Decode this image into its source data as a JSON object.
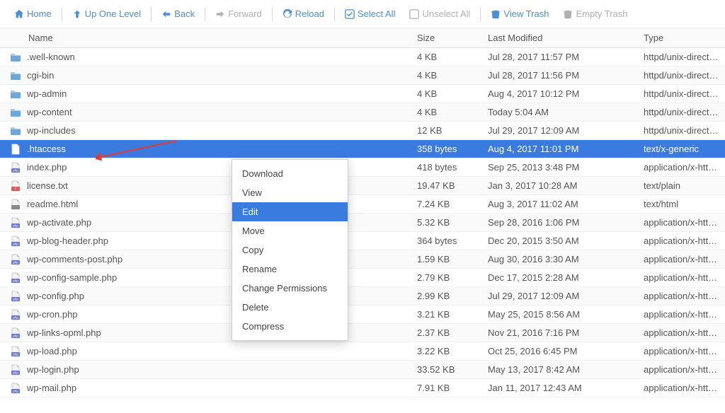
{
  "toolbar": {
    "home": "Home",
    "up": "Up One Level",
    "back": "Back",
    "forward": "Forward",
    "reload": "Reload",
    "select_all": "Select All",
    "unselect_all": "Unselect All",
    "view_trash": "View Trash",
    "empty_trash": "Empty Trash"
  },
  "columns": {
    "name": "Name",
    "size": "Size",
    "modified": "Last Modified",
    "type": "Type"
  },
  "files": [
    {
      "icon": "folder",
      "name": ".well-known",
      "size": "4 KB",
      "modified": "Jul 28, 2017 11:57 PM",
      "type": "httpd/unix-directory"
    },
    {
      "icon": "folder",
      "name": "cgi-bin",
      "size": "4 KB",
      "modified": "Jul 28, 2017 11:56 PM",
      "type": "httpd/unix-directory"
    },
    {
      "icon": "folder",
      "name": "wp-admin",
      "size": "4 KB",
      "modified": "Aug 4, 2017 10:12 PM",
      "type": "httpd/unix-directory"
    },
    {
      "icon": "folder",
      "name": "wp-content",
      "size": "4 KB",
      "modified": "Today 5:04 AM",
      "type": "httpd/unix-directory"
    },
    {
      "icon": "folder",
      "name": "wp-includes",
      "size": "12 KB",
      "modified": "Jul 29, 2017 12:09 AM",
      "type": "httpd/unix-directory"
    },
    {
      "icon": "file",
      "name": ".htaccess",
      "size": "358 bytes",
      "modified": "Aug 4, 2017 11:01 PM",
      "type": "text/x-generic",
      "selected": true
    },
    {
      "icon": "php",
      "name": "index.php",
      "size": "418 bytes",
      "modified": "Sep 25, 2013 3:48 PM",
      "type": "application/x-httpd-php"
    },
    {
      "icon": "txt",
      "name": "license.txt",
      "size": "19.47 KB",
      "modified": "Jan 3, 2017 10:28 AM",
      "type": "text/plain"
    },
    {
      "icon": "html",
      "name": "readme.html",
      "size": "7.24 KB",
      "modified": "Aug 3, 2017 11:02 AM",
      "type": "text/html"
    },
    {
      "icon": "php",
      "name": "wp-activate.php",
      "size": "5.32 KB",
      "modified": "Sep 28, 2016 1:06 PM",
      "type": "application/x-httpd-php"
    },
    {
      "icon": "php",
      "name": "wp-blog-header.php",
      "size": "364 bytes",
      "modified": "Dec 20, 2015 3:50 AM",
      "type": "application/x-httpd-php"
    },
    {
      "icon": "php",
      "name": "wp-comments-post.php",
      "size": "1.59 KB",
      "modified": "Aug 30, 2016 3:30 AM",
      "type": "application/x-httpd-php"
    },
    {
      "icon": "php",
      "name": "wp-config-sample.php",
      "size": "2.79 KB",
      "modified": "Dec 17, 2015 2:28 AM",
      "type": "application/x-httpd-php"
    },
    {
      "icon": "php",
      "name": "wp-config.php",
      "size": "2.99 KB",
      "modified": "Jul 29, 2017 12:09 AM",
      "type": "application/x-httpd-php"
    },
    {
      "icon": "php",
      "name": "wp-cron.php",
      "size": "3.21 KB",
      "modified": "May 25, 2015 8:56 AM",
      "type": "application/x-httpd-php"
    },
    {
      "icon": "php",
      "name": "wp-links-opml.php",
      "size": "2.37 KB",
      "modified": "Nov 21, 2016 7:16 PM",
      "type": "application/x-httpd-php"
    },
    {
      "icon": "php",
      "name": "wp-load.php",
      "size": "3.22 KB",
      "modified": "Oct 25, 2016 6:45 PM",
      "type": "application/x-httpd-php"
    },
    {
      "icon": "php",
      "name": "wp-login.php",
      "size": "33.52 KB",
      "modified": "May 13, 2017 8:42 AM",
      "type": "application/x-httpd-php"
    },
    {
      "icon": "php",
      "name": "wp-mail.php",
      "size": "7.91 KB",
      "modified": "Jan 11, 2017 12:43 AM",
      "type": "application/x-httpd-php"
    }
  ],
  "context_menu": {
    "items": [
      {
        "label": "Download"
      },
      {
        "label": "View"
      },
      {
        "label": "Edit",
        "highlight": true
      },
      {
        "label": "Move"
      },
      {
        "label": "Copy"
      },
      {
        "label": "Rename"
      },
      {
        "label": "Change Permissions"
      },
      {
        "label": "Delete"
      },
      {
        "label": "Compress"
      }
    ]
  }
}
